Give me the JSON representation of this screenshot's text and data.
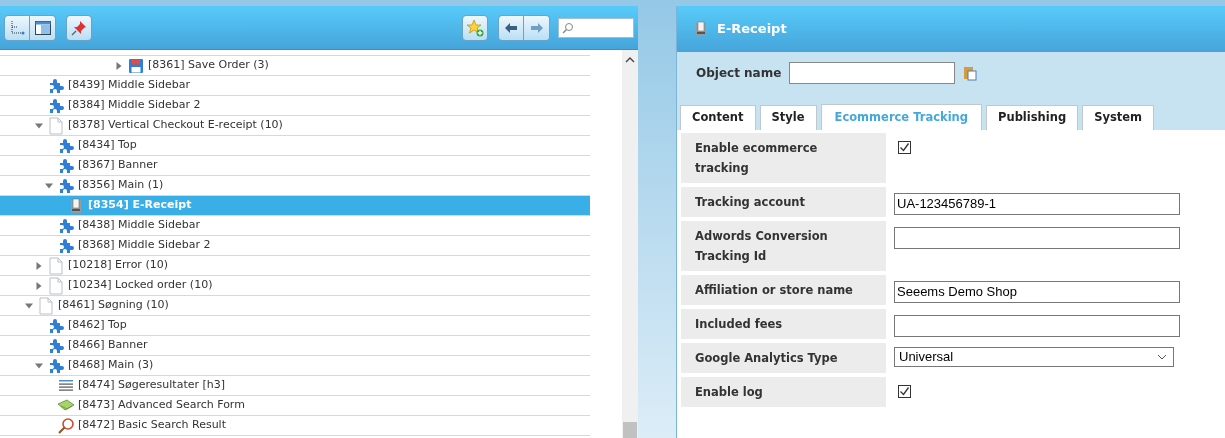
{
  "tree": {
    "branch_tail": [
      {
        "label": "[8361] Save Order (3)",
        "kind": "save",
        "expanded": false,
        "selected": false
      }
    ],
    "siblings": [
      {
        "label": "[8439] Middle Sidebar",
        "kind": "module",
        "selected": false
      },
      {
        "label": "[8384] Middle Sidebar 2",
        "kind": "module",
        "selected": false
      },
      {
        "label": "[8378] Vertical Checkout E-receipt (10)",
        "kind": "page",
        "expanded": true,
        "selected": false,
        "children": [
          {
            "label": "[8434] Top",
            "kind": "module",
            "selected": false
          },
          {
            "label": "[8367] Banner",
            "kind": "module",
            "selected": false
          },
          {
            "label": "[8356] Main (1)",
            "kind": "module",
            "expanded": true,
            "selected": false,
            "children": [
              {
                "label": "[8354] E-Receipt",
                "kind": "receipt",
                "selected": true
              }
            ]
          },
          {
            "label": "[8438] Middle Sidebar",
            "kind": "module",
            "selected": false
          },
          {
            "label": "[8368] Middle Sidebar 2",
            "kind": "module",
            "selected": false
          }
        ]
      },
      {
        "label": "[10218] Error (10)",
        "kind": "page",
        "expanded": false,
        "selected": false
      },
      {
        "label": "[10234] Locked order (10)",
        "kind": "page",
        "expanded": false,
        "selected": false
      }
    ],
    "items": [
      {
        "label": "[8461] Søgning (10)",
        "kind": "page",
        "expanded": true,
        "selected": false,
        "children": [
          {
            "label": "[8462] Top",
            "kind": "module",
            "selected": false
          },
          {
            "label": "[8466] Banner",
            "kind": "module",
            "selected": false
          },
          {
            "label": "[8468] Main (3)",
            "kind": "module",
            "expanded": true,
            "selected": false,
            "children": [
              {
                "label": "[8474] Søgeresultater [h3]",
                "kind": "list",
                "selected": false
              },
              {
                "label": "[8473] Advanced Search Form",
                "kind": "form",
                "selected": false
              },
              {
                "label": "[8472] Basic Search Result",
                "kind": "search",
                "selected": false
              }
            ]
          }
        ]
      }
    ]
  },
  "panel": {
    "title": "E-Receipt",
    "object_name": {
      "label": "Object name"
    },
    "tabs": [
      {
        "label": "Content",
        "selected": false
      },
      {
        "label": "Style",
        "selected": false
      },
      {
        "label": "Ecommerce Tracking",
        "selected": true
      },
      {
        "label": "Publishing",
        "selected": false
      },
      {
        "label": "System",
        "selected": false
      }
    ],
    "fields": [
      {
        "kind": "checkbox",
        "label": "Enable ecommerce tracking",
        "checked": true
      },
      {
        "kind": "text",
        "label": "Tracking account",
        "value": "UA-123456789-1"
      },
      {
        "kind": "text",
        "label": "Adwords Conversion Tracking Id"
      },
      {
        "kind": "text",
        "label": "Affiliation or store name",
        "value": "Seeems Demo Shop"
      },
      {
        "kind": "text",
        "label": "Included fees"
      },
      {
        "kind": "select",
        "label": "Google Analytics Type",
        "value": "Universal"
      },
      {
        "kind": "checkbox",
        "label": "Enable log",
        "checked": true
      }
    ]
  }
}
